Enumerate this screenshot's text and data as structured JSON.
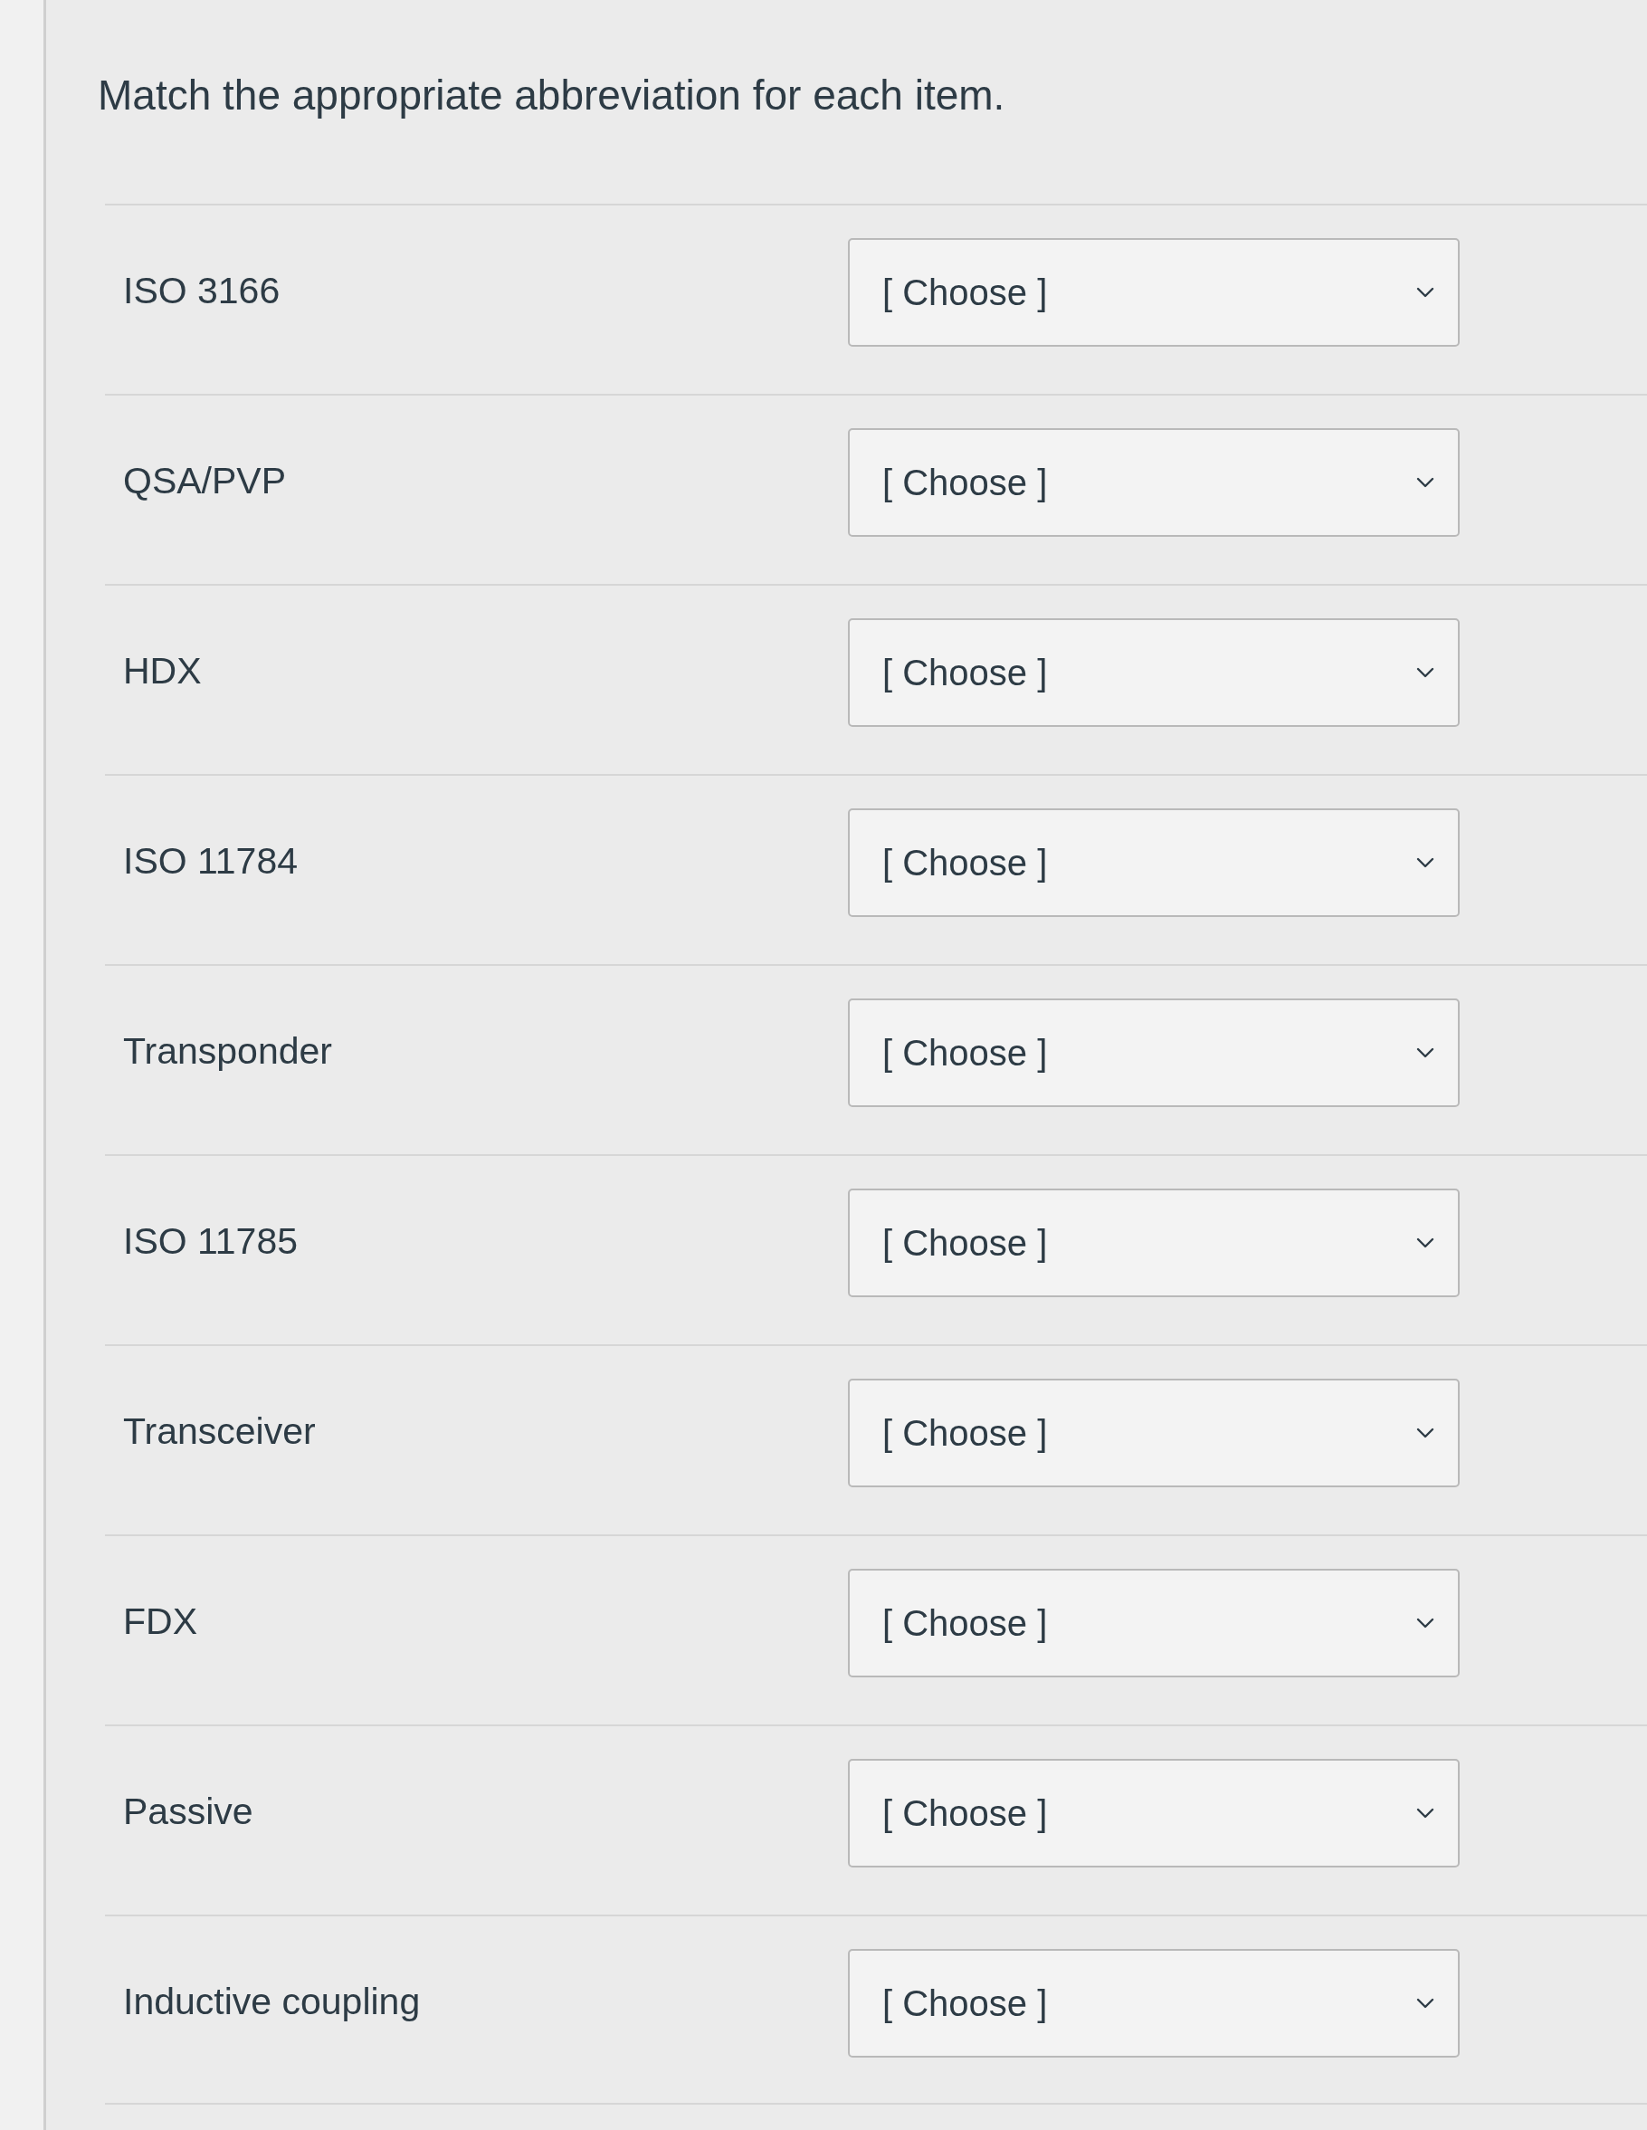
{
  "title": "Match the appropriate abbreviation for each item.",
  "items": [
    {
      "label": "ISO 3166",
      "selection": "[ Choose ]"
    },
    {
      "label": "QSA/PVP",
      "selection": "[ Choose ]"
    },
    {
      "label": "HDX",
      "selection": "[ Choose ]"
    },
    {
      "label": "ISO 11784",
      "selection": "[ Choose ]"
    },
    {
      "label": "Transponder",
      "selection": "[ Choose ]"
    },
    {
      "label": "ISO 11785",
      "selection": "[ Choose ]"
    },
    {
      "label": "Transceiver",
      "selection": "[ Choose ]"
    },
    {
      "label": "FDX",
      "selection": "[ Choose ]"
    },
    {
      "label": "Passive",
      "selection": "[ Choose ]"
    },
    {
      "label": "Inductive coupling",
      "selection": "[ Choose ]"
    }
  ]
}
